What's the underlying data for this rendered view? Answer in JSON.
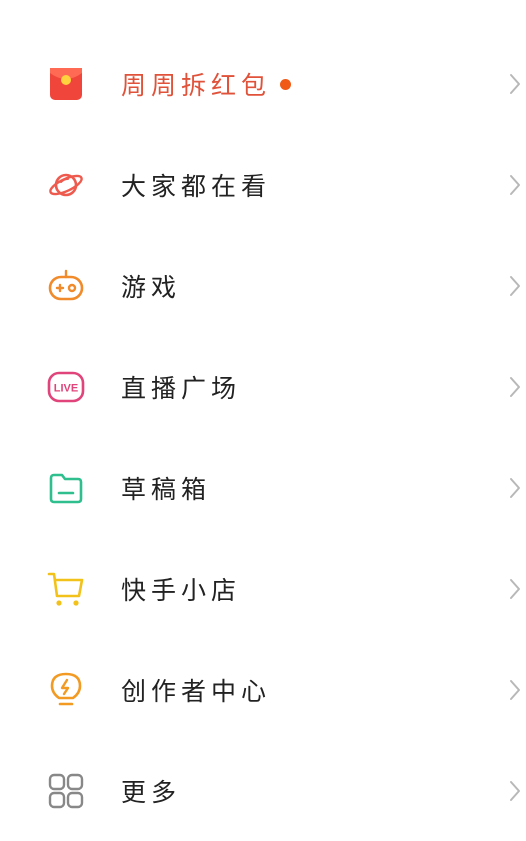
{
  "menu": {
    "items": [
      {
        "label": "周周拆红包",
        "icon": "red-envelope-icon",
        "highlight": true,
        "has_dot": true
      },
      {
        "label": "大家都在看",
        "icon": "planet-icon"
      },
      {
        "label": "游戏",
        "icon": "gamepad-icon"
      },
      {
        "label": "直播广场",
        "icon": "live-badge-icon",
        "icon_text": "LIVE"
      },
      {
        "label": "草稿箱",
        "icon": "folder-icon"
      },
      {
        "label": "快手小店",
        "icon": "shopping-cart-icon"
      },
      {
        "label": "创作者中心",
        "icon": "lightbulb-icon"
      },
      {
        "label": "更多",
        "icon": "grid-icon"
      }
    ]
  },
  "colors": {
    "highlight_text": "#e0523a",
    "dot": "#f05a16",
    "red_envelope": "#f0453a",
    "planet": "#ee5a4e",
    "gamepad": "#f08a2a",
    "live": "#e0447a",
    "folder": "#2fbf8e",
    "cart": "#f2c21a",
    "lightbulb": "#f29a22",
    "grid": "#888888",
    "chevron": "#b8b8b8"
  }
}
